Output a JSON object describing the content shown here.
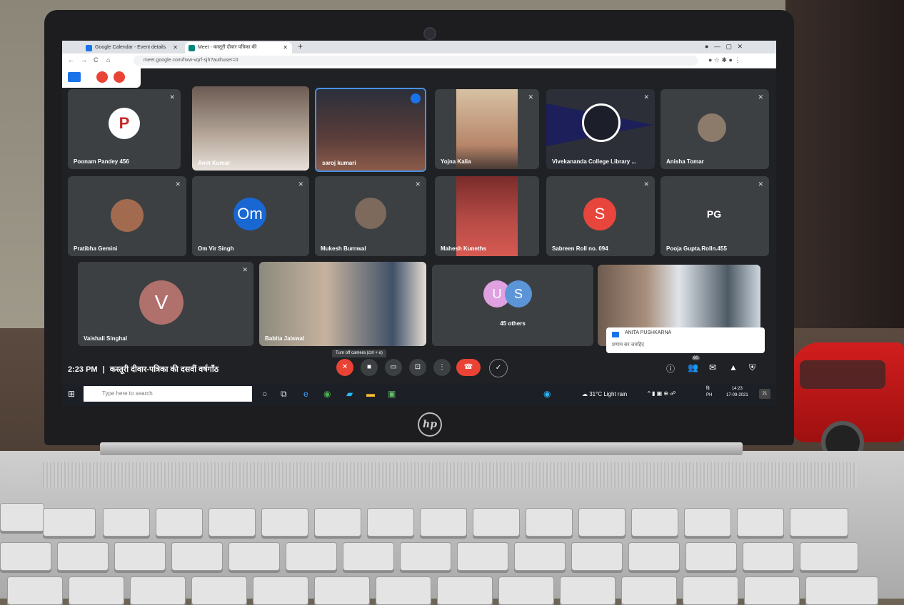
{
  "browser": {
    "tabs": [
      {
        "label": "Google Calendar - Event details",
        "active": false
      },
      {
        "label": "Meet - कस्तूरी दीवार पत्रिका की",
        "active": true
      }
    ],
    "url": "meet.google.com/hxw-vqrf-sjh?authuser=0"
  },
  "meet": {
    "participants": [
      {
        "name": "Poonam Pandey 456",
        "avatar_text": "P"
      },
      {
        "name": "Amit Kumar"
      },
      {
        "name": "saroj kumari"
      },
      {
        "name": "Yojna Kalia"
      },
      {
        "name": "Vivekananda College Library ..."
      },
      {
        "name": "Anisha Tomar"
      },
      {
        "name": "Pratibha Gemini"
      },
      {
        "name": "Om Vir Singh",
        "avatar_text": "Om"
      },
      {
        "name": "Mukesh Burnwal"
      },
      {
        "name": "Mahesh Kuneths"
      },
      {
        "name": "Sabreen Roll no. 094",
        "avatar_text": "S"
      },
      {
        "name": "Pooja Gupta.Rolln.455",
        "avatar_text": "PG"
      },
      {
        "name": "Vaishali Singhal",
        "avatar_text": "V"
      },
      {
        "name": "Babita Jaiswal"
      },
      {
        "name": "45 others",
        "avatar_text_1": "U",
        "avatar_text_2": "S"
      }
    ],
    "toast": {
      "name": "ANITA PUSHKARNA",
      "message": "प्रणाम सर जयहिंद"
    },
    "meeting_time": "2:23 PM",
    "meeting_separator": "|",
    "meeting_title": "कस्तूरी दीवार-पत्रिका की दसवीं वर्षगाँठ",
    "tooltip": "Turn off camera (ctrl + e)",
    "people_count": "60"
  },
  "taskbar": {
    "search_placeholder": "Type here to search",
    "weather": "31°C  Light rain",
    "lang": "हि",
    "lang2": "PH",
    "time": "14:23",
    "date": "17-09-2021",
    "notifications": "21"
  },
  "colors": {
    "meet_bg": "#202124",
    "tile_bg": "#3c4043",
    "end_call": "#ea4335",
    "mic_off": "#ea4335",
    "chrome_accent": "#1a73e8"
  }
}
